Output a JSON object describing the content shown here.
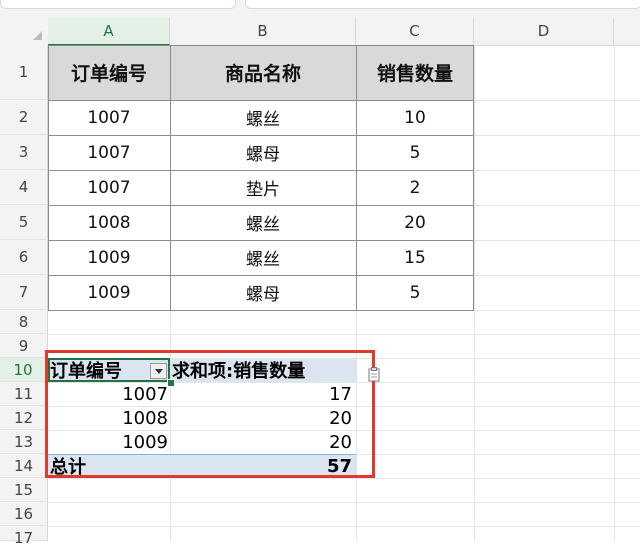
{
  "columns": [
    "A",
    "B",
    "C",
    "D"
  ],
  "rows": [
    "1",
    "2",
    "3",
    "4",
    "5",
    "6",
    "7",
    "8",
    "9",
    "10",
    "11",
    "12",
    "13",
    "14",
    "15",
    "16",
    "17"
  ],
  "table": {
    "headers": [
      "订单编号",
      "商品名称",
      "销售数量"
    ],
    "rows": [
      [
        "1007",
        "螺丝",
        "10"
      ],
      [
        "1007",
        "螺母",
        "5"
      ],
      [
        "1007",
        "垫片",
        "2"
      ],
      [
        "1008",
        "螺丝",
        "20"
      ],
      [
        "1009",
        "螺丝",
        "15"
      ],
      [
        "1009",
        "螺母",
        "5"
      ]
    ]
  },
  "pivot": {
    "row_label": "订单编号",
    "value_label": "求和项:销售数量",
    "rows": [
      {
        "key": "1007",
        "value": "17"
      },
      {
        "key": "1008",
        "value": "20"
      },
      {
        "key": "1009",
        "value": "20"
      }
    ],
    "total_label": "总计",
    "total_value": "57"
  },
  "selection": {
    "column": "A",
    "row": "10"
  },
  "colors": {
    "highlight": "#e03a2f",
    "selection": "#217346",
    "pivot_header": "#dbe5f1"
  }
}
